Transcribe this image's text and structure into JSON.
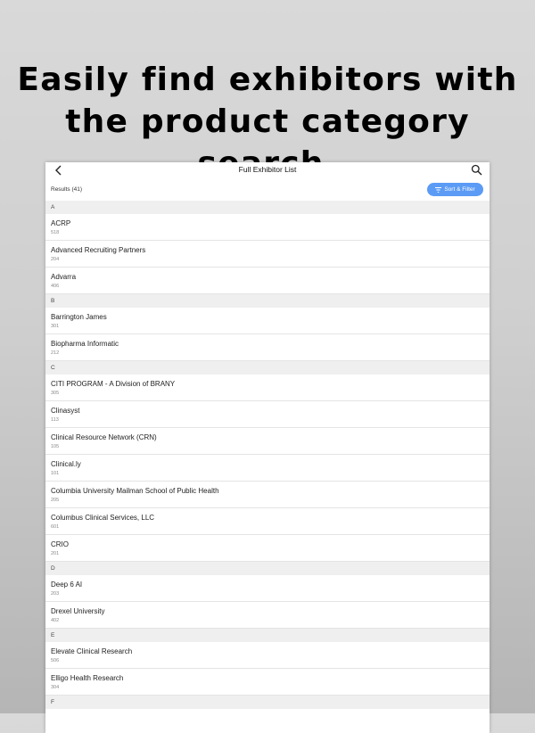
{
  "headline": [
    "Easily find exhibitors with",
    "the product category search."
  ],
  "navbar": {
    "title": "Full Exhibitor List"
  },
  "results": {
    "label": "Results (41)",
    "sort_label": "Sort & Filter"
  },
  "colors": {
    "accent": "#5b9bf5",
    "section_bg": "#efefef"
  },
  "sections": [
    {
      "letter": "A",
      "items": [
        {
          "name": "ACRP",
          "booth": "518"
        },
        {
          "name": "Advanced Recruiting Partners",
          "booth": "204"
        },
        {
          "name": "Advarra",
          "booth": "406"
        }
      ]
    },
    {
      "letter": "B",
      "items": [
        {
          "name": "Barrington James",
          "booth": "301"
        },
        {
          "name": "Biopharma Informatic",
          "booth": "212"
        }
      ]
    },
    {
      "letter": "C",
      "items": [
        {
          "name": "CITI PROGRAM - A Division of BRANY",
          "booth": "305"
        },
        {
          "name": "Clinasyst",
          "booth": "113"
        },
        {
          "name": "Clinical Resource Network (CRN)",
          "booth": "105"
        },
        {
          "name": "Clinical.ly",
          "booth": "101"
        },
        {
          "name": "Columbia University Mailman School of Public Health",
          "booth": "205"
        },
        {
          "name": "Columbus Clinical Services, LLC",
          "booth": "601"
        },
        {
          "name": "CRIO",
          "booth": "201"
        }
      ]
    },
    {
      "letter": "D",
      "items": [
        {
          "name": "Deep 6 AI",
          "booth": "203"
        },
        {
          "name": "Drexel University",
          "booth": "402"
        }
      ]
    },
    {
      "letter": "E",
      "items": [
        {
          "name": "Elevate Clinical Research",
          "booth": "506"
        },
        {
          "name": "Elligo Health Research",
          "booth": "304"
        }
      ]
    },
    {
      "letter": "F",
      "items": []
    }
  ]
}
